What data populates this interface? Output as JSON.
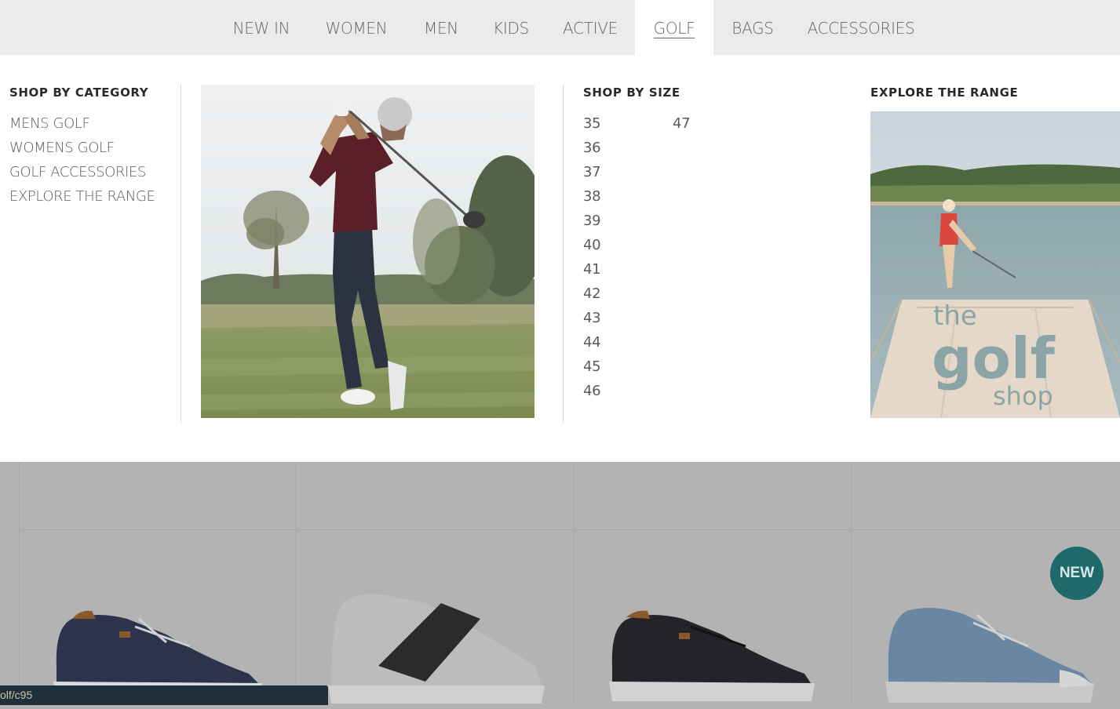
{
  "nav": {
    "items": [
      {
        "label": "NEW IN"
      },
      {
        "label": "WOMEN"
      },
      {
        "label": "MEN"
      },
      {
        "label": "KIDS"
      },
      {
        "label": "ACTIVE"
      },
      {
        "label": "GOLF",
        "active": true
      },
      {
        "label": "BAGS"
      },
      {
        "label": "ACCESSORIES"
      }
    ]
  },
  "mega_menu": {
    "category": {
      "title": "SHOP BY CATEGORY",
      "links": [
        "MENS GOLF",
        "WOMENS GOLF",
        "GOLF ACCESSORIES",
        "EXPLORE THE RANGE"
      ]
    },
    "size": {
      "title": "SHOP BY SIZE",
      "sizes": [
        "35",
        "36",
        "37",
        "38",
        "39",
        "40",
        "41",
        "42",
        "43",
        "44",
        "45",
        "46",
        "47"
      ]
    },
    "explore": {
      "title": "EXPLORE THE RANGE",
      "banner_text_line1": "the",
      "banner_text_line2": "golf",
      "banner_text_line3": "shop"
    }
  },
  "product_grid": {
    "badge": "NEW"
  },
  "status_bar": {
    "url": "olf/c95"
  },
  "colors": {
    "nav_bg": "#ebebeb",
    "overlay": "#b3b3b3",
    "badge": "#1e6a6a",
    "status_bg": "#1f2f3c"
  }
}
